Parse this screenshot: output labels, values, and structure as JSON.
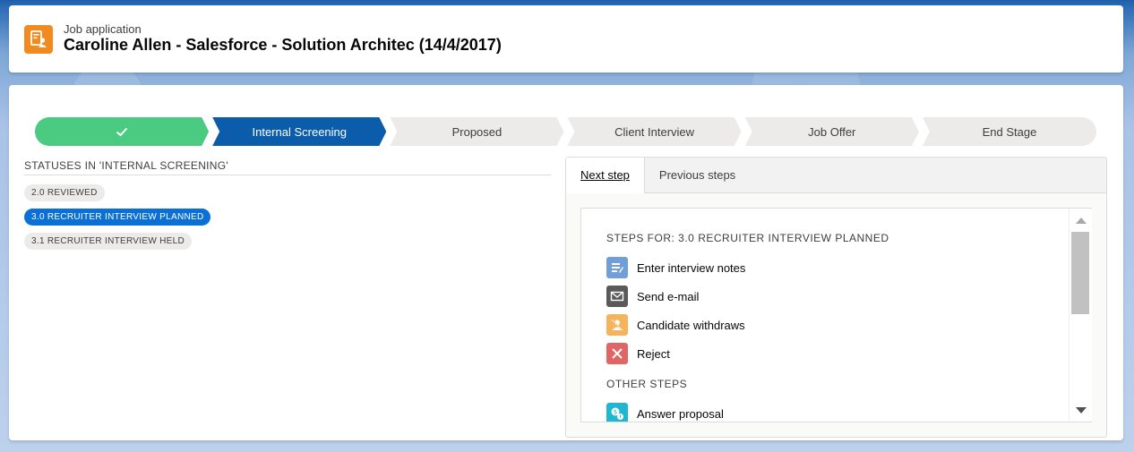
{
  "header": {
    "eyebrow": "Job application",
    "title": "Caroline Allen - Salesforce - Solution Architec (14/4/2017)",
    "icon": "job-application-icon",
    "icon_color": "#f28b1f"
  },
  "path": {
    "stages": [
      {
        "label": "",
        "state": "complete"
      },
      {
        "label": "Internal Screening",
        "state": "current"
      },
      {
        "label": "Proposed",
        "state": "incomplete"
      },
      {
        "label": "Client Interview",
        "state": "incomplete"
      },
      {
        "label": "Job Offer",
        "state": "incomplete"
      },
      {
        "label": "End Stage",
        "state": "incomplete"
      }
    ],
    "complete_color": "#4bca81",
    "current_color": "#0b5cab"
  },
  "statuses": {
    "heading": "STATUSES IN 'INTERNAL SCREENING'",
    "items": [
      {
        "label": "2.0 REVIEWED",
        "active": false
      },
      {
        "label": "3.0 RECRUITER INTERVIEW PLANNED",
        "active": true
      },
      {
        "label": "3.1 RECRUITER INTERVIEW HELD",
        "active": false
      }
    ]
  },
  "tabs": {
    "items": [
      {
        "label": "Next step",
        "active": true
      },
      {
        "label": "Previous steps",
        "active": false
      }
    ]
  },
  "steps": {
    "heading": "STEPS FOR: 3.0 RECRUITER INTERVIEW PLANNED",
    "items": [
      {
        "label": "Enter interview notes",
        "icon": "notes-icon",
        "color": "#6f9ed8"
      },
      {
        "label": "Send e-mail",
        "icon": "email-icon",
        "color": "#5a5a5a"
      },
      {
        "label": "Candidate withdraws",
        "icon": "user-remove-icon",
        "color": "#f5b45c"
      },
      {
        "label": "Reject",
        "icon": "close-icon",
        "color": "#e06565"
      }
    ],
    "other_heading": "OTHER STEPS",
    "other_items": [
      {
        "label": "Answer proposal",
        "icon": "answer-proposal-icon",
        "color": "#1fb6d0"
      }
    ]
  }
}
